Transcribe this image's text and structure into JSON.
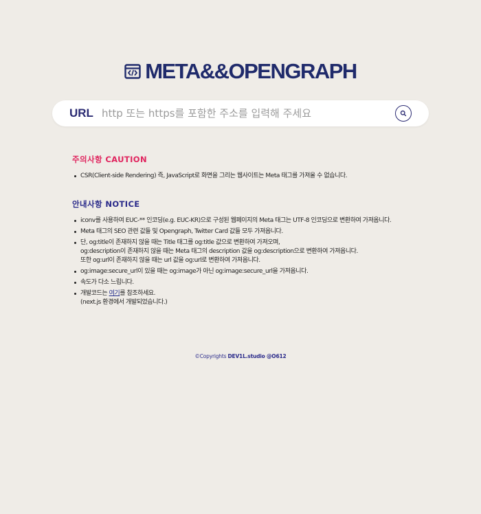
{
  "header": {
    "title": "META&&OPENGRAPH",
    "icon": "code-icon"
  },
  "search": {
    "label": "URL",
    "value": "",
    "placeholder": "http 또는 https를 포함한 주소를 입력해 주세요",
    "button_icon": "search-icon"
  },
  "caution": {
    "title": "주의사항 CAUTION",
    "items": [
      "CSR(Client-side Rendering) 즉, JavaScript로 화면을 그리는 웹사이트는 Meta 태그를 가져올 수 없습니다."
    ]
  },
  "notice": {
    "title": "안내사항 NOTICE",
    "items": [
      "iconv를 사용하여 EUC-** 인코딩(e.g. EUC-KR)으로 구성된 웹페이지의 Meta 태그는 UTF-8 인코딩으로 변환하여 가져옵니다.",
      "Meta 태그의 SEO 관련 값들 및 Opengraph, Twitter Card 값들 모두 가져옵니다.",
      {
        "line1": "단, og:title이 존재하지 않을 때는 Title 태그를 og:title 값으로 변환하여 가져오며,",
        "line2": "og:description이 존재하지 않을 때는 Meta 태그의 description 값을 og:description으로 변환하여 가져옵니다.",
        "line3": "또한 og:url이 존재하지 않을 때는 url 값을 og:url로 변환하여 가져옵니다."
      },
      "og:image:secure_url이 있을 때는 og:image가 아닌 og:image:secure_url을 가져옵니다.",
      "속도가 다소 느립니다.",
      {
        "prefix": "개발코드는 ",
        "link": "여기",
        "suffix": "를 참조하세요.",
        "line2": "(next.js 환경에서 개발되었습니다.)"
      }
    ]
  },
  "footer": {
    "prefix": "©Copyrights ",
    "brand": "DEV1L.studio @O612"
  },
  "colors": {
    "background": "#efece7",
    "primary": "#1f2a6b",
    "caution": "#e0245e",
    "notice": "#2a2a8a"
  }
}
